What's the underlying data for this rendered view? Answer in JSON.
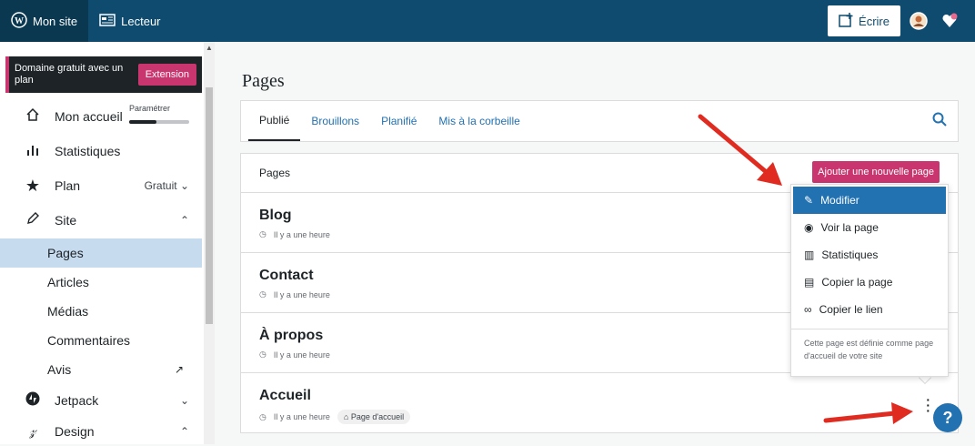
{
  "topbar": {
    "my_site": "Mon site",
    "reader": "Lecteur",
    "write": "Écrire"
  },
  "sidebar": {
    "promo_text": "Domaine gratuit avec un plan",
    "promo_button": "Extension",
    "home": "Mon accueil",
    "home_setting": "Paramétrer",
    "home_progress": 0.45,
    "stats": "Statistiques",
    "plan": "Plan",
    "plan_value": "Gratuit",
    "site": "Site",
    "subitems": [
      "Pages",
      "Articles",
      "Médias",
      "Commentaires",
      "Avis"
    ],
    "jetpack": "Jetpack",
    "design": "Design"
  },
  "main": {
    "title": "Pages",
    "tabs": [
      "Publié",
      "Brouillons",
      "Planifié",
      "Mis à la corbeille"
    ],
    "list_header": "Pages",
    "add_button": "Ajouter une nouvelle page",
    "pages": [
      {
        "title": "Blog",
        "meta": "Il y a une heure",
        "badge": ""
      },
      {
        "title": "Contact",
        "meta": "Il y a une heure",
        "badge": ""
      },
      {
        "title": "À propos",
        "meta": "Il y a une heure",
        "badge": ""
      },
      {
        "title": "Accueil",
        "meta": "Il y a une heure",
        "badge": "Page d'accueil"
      }
    ]
  },
  "menu": {
    "items": [
      "Modifier",
      "Voir la page",
      "Statistiques",
      "Copier la page",
      "Copier le lien"
    ],
    "note": "Cette page est définie comme page d'accueil de votre site"
  },
  "colors": {
    "topbar": "#0e4b6e",
    "accent": "#2271b1",
    "pink": "#c9356e",
    "arrow": "#e02b20"
  }
}
